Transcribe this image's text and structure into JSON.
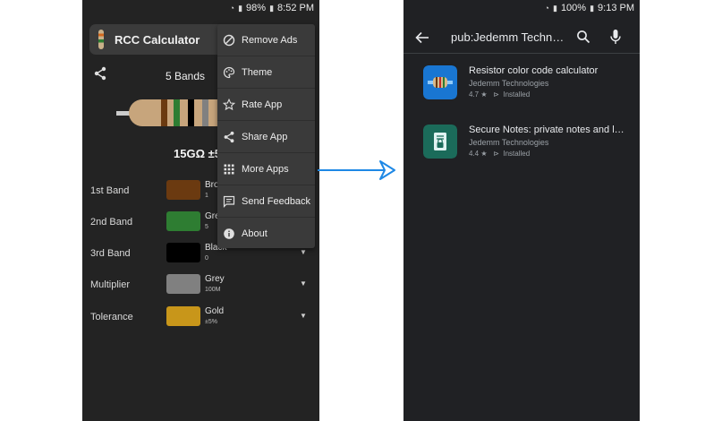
{
  "left_phone": {
    "status": {
      "battery": "98%",
      "time": "8:52 PM"
    },
    "app_title": "RCC Calculator",
    "bands_label": "5 Bands",
    "result": "15GΩ ±5",
    "bands": [
      {
        "name": "1st Band",
        "color_name": "Bro",
        "value": "1",
        "hex": "#6b3a10"
      },
      {
        "name": "2nd Band",
        "color_name": "Gre",
        "value": "5",
        "hex": "#2e7d32"
      },
      {
        "name": "3rd Band",
        "color_name": "Black",
        "value": "0",
        "hex": "#000000"
      },
      {
        "name": "Multiplier",
        "color_name": "Grey",
        "value": "100M",
        "hex": "#808080"
      },
      {
        "name": "Tolerance",
        "color_name": "Gold",
        "value": "±5%",
        "hex": "#c8961a"
      }
    ],
    "menu": [
      {
        "label": "Remove Ads",
        "icon": "block-icon"
      },
      {
        "label": "Theme",
        "icon": "palette-icon"
      },
      {
        "label": "Rate App",
        "icon": "star-icon"
      },
      {
        "label": "Share App",
        "icon": "share-icon"
      },
      {
        "label": "More Apps",
        "icon": "apps-grid-icon"
      },
      {
        "label": "Send Feedback",
        "icon": "feedback-icon"
      },
      {
        "label": "About",
        "icon": "info-icon"
      }
    ]
  },
  "right_phone": {
    "status": {
      "battery": "100%",
      "time": "9:13 PM"
    },
    "search_query": "pub:Jedemm Technologies",
    "results": [
      {
        "title": "Resistor color code calculator",
        "developer": "Jedemm Technologies",
        "rating": "4.7 ★",
        "status": "Installed"
      },
      {
        "title": "Secure Notes: private notes and lists",
        "developer": "Jedemm Technologies",
        "rating": "4.4 ★",
        "status": "Installed"
      }
    ]
  },
  "colors": {
    "arrow": "#1e88e5",
    "left_bg": "#232323",
    "right_bg": "#202124"
  }
}
